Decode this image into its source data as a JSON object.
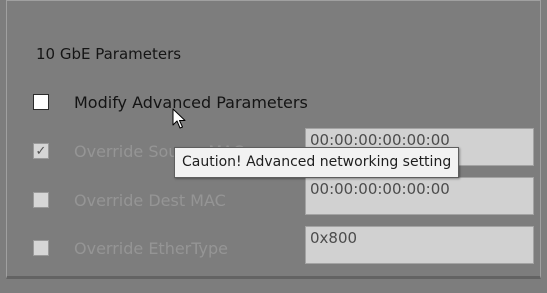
{
  "section": {
    "title": "10 GbE Parameters"
  },
  "modify_advanced": {
    "label": "Modify Advanced Parameters",
    "checked": false,
    "enabled": true
  },
  "rows": [
    {
      "label": "Override Source MAC",
      "checked": true,
      "enabled": false,
      "value": "00:00:00:00:00:00"
    },
    {
      "label": "Override Dest MAC",
      "checked": false,
      "enabled": false,
      "value": "00:00:00:00:00:00"
    },
    {
      "label": "Override EtherType",
      "checked": false,
      "enabled": false,
      "value": "0x800"
    }
  ],
  "tooltip": {
    "text": "Caution! Advanced networking setting"
  },
  "icons": {
    "checkmark": "check-icon",
    "cursor": "mouse-pointer-icon"
  },
  "colors": {
    "panel_background": "#7d7d7d",
    "disabled_text": "#959595",
    "field_background": "#d1d1d1",
    "tooltip_background": "#f2f2f2"
  }
}
